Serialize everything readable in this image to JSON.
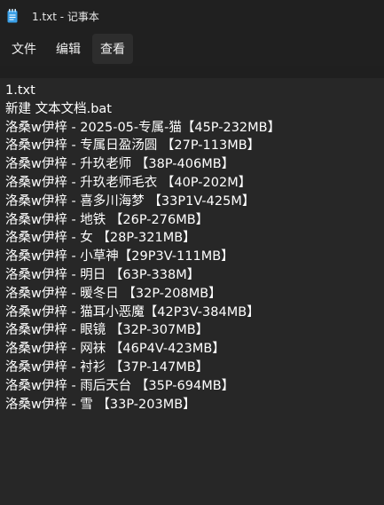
{
  "window": {
    "title": "1.txt - 记事本",
    "icon": "notepad-icon"
  },
  "menu": {
    "file": "文件",
    "edit": "编辑",
    "view": "查看"
  },
  "editor": {
    "lines": [
      "1.txt",
      "新建 文本文档.bat",
      "洛桑w伊梓 - 2025-05-专属-猫【45P-232MB】",
      "洛桑w伊梓 - 专属日盈汤圆 【27P-113MB】",
      "洛桑w伊梓 - 升玖老师 【38P-406MB】",
      "洛桑w伊梓 - 升玖老师毛衣 【40P-202M】",
      "洛桑w伊梓 - 喜多川海梦 【33P1V-425M】",
      "洛桑w伊梓 - 地铁 【26P-276MB】",
      "洛桑w伊梓 - 女 【28P-321MB】",
      "洛桑w伊梓 - 小草神【29P3V-111MB】",
      "洛桑w伊梓 - 明日 【63P-338M】",
      "洛桑w伊梓 - 暖冬日 【32P-208MB】",
      "洛桑w伊梓 - 猫耳小恶魔【42P3V-384MB】",
      "洛桑w伊梓 - 眼镜 【32P-307MB】",
      "洛桑w伊梓 - 网袜 【46P4V-423MB】",
      "洛桑w伊梓 - 衬衫 【37P-147MB】",
      "洛桑w伊梓 - 雨后天台 【35P-694MB】",
      "洛桑w伊梓 - 雪 【33P-203MB】"
    ]
  }
}
